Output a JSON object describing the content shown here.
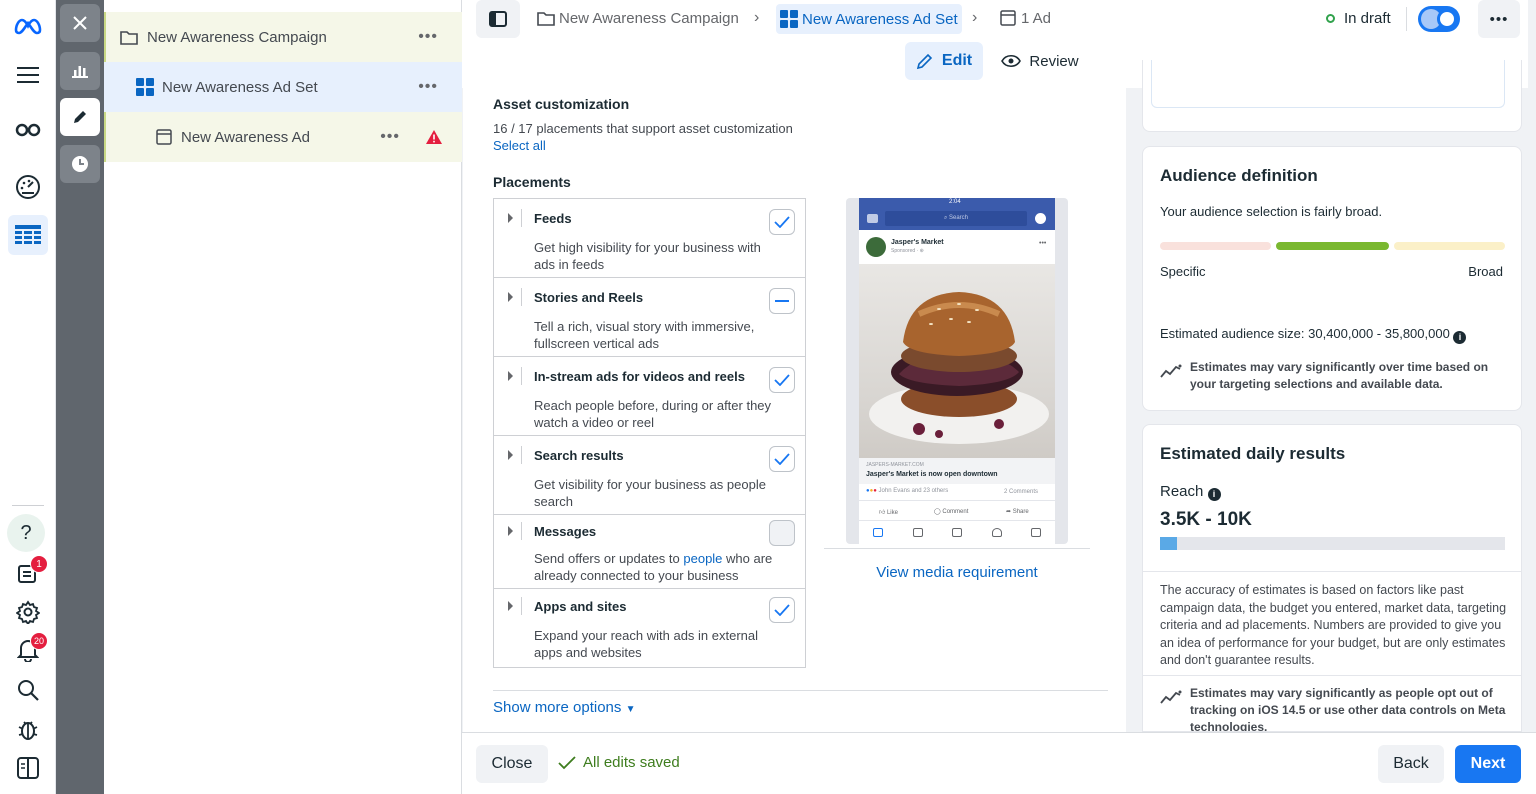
{
  "colors": {
    "accent": "#1877f2",
    "ok": "#31a24c",
    "warn": "#e41e3f",
    "selected_bg": "#e7f0fd"
  },
  "rail": {
    "notifications_badge": "1",
    "alerts_badge": "20"
  },
  "tree": {
    "campaign": "New Awareness Campaign",
    "adset": "New Awareness Ad Set",
    "ad": "New Awareness Ad",
    "more": "•••"
  },
  "header": {
    "crumb_campaign": "New Awareness Campaign",
    "crumb_adset": "New Awareness Ad Set",
    "crumb_ad": "1 Ad",
    "status": "In draft",
    "more": "•••",
    "edit": "Edit",
    "review": "Review"
  },
  "asset": {
    "title": "Asset customization",
    "subtitle": "16 / 17 placements that support asset customization",
    "select_all": "Select all"
  },
  "placements": {
    "title": "Placements",
    "items": [
      {
        "title": "Feeds",
        "desc": "Get high visibility for your business with ads in feeds",
        "state": "checked"
      },
      {
        "title": "Stories and Reels",
        "desc": "Tell a rich, visual story with immersive, fullscreen vertical ads",
        "state": "partial"
      },
      {
        "title": "In-stream ads for videos and reels",
        "desc": "Reach people before, during or after they watch a video or reel",
        "state": "checked"
      },
      {
        "title": "Search results",
        "desc": "Get visibility for your business as people search",
        "state": "checked"
      },
      {
        "title": "Messages",
        "desc_pre": "Send offers or updates to ",
        "desc_link": "people",
        "desc_post": " who are already connected to your business",
        "state": "unchecked"
      },
      {
        "title": "Apps and sites",
        "desc": "Expand your reach with ads in external apps and websites",
        "state": "checked"
      }
    ],
    "show_more": "Show more options"
  },
  "preview": {
    "time": "2:04",
    "search": "Search",
    "page_name": "Jasper's Market",
    "sponsored": "Sponsored · ⊕",
    "domain": "JASPERS-MARKET.COM",
    "headline": "Jasper's Market is now open downtown",
    "reactions": "John Evans and 23 others",
    "comments": "2 Comments",
    "like": "Like",
    "comment": "Comment",
    "share": "Share",
    "media_link": "View media requirement"
  },
  "audience": {
    "title": "Audience definition",
    "desc": "Your audience selection is fairly broad.",
    "specific": "Specific",
    "broad": "Broad",
    "size": "Estimated audience size: 30,400,000 - 35,800,000",
    "note": "Estimates may vary significantly over time based on your targeting selections and available data."
  },
  "daily": {
    "title": "Estimated daily results",
    "reach_label": "Reach",
    "reach_value": "3.5K - 10K",
    "reach_fill_fraction": 0.05,
    "accuracy": "The accuracy of estimates is based on factors like past campaign data, the budget you entered, market data, targeting criteria and ad placements. Numbers are provided to give you an idea of performance for your budget, but are only estimates and don't guarantee results.",
    "note": "Estimates may vary significantly as people opt out of tracking on iOS 14.5 or use other data controls on Meta technologies."
  },
  "footer": {
    "close": "Close",
    "saved": "All edits saved",
    "back": "Back",
    "next": "Next"
  }
}
